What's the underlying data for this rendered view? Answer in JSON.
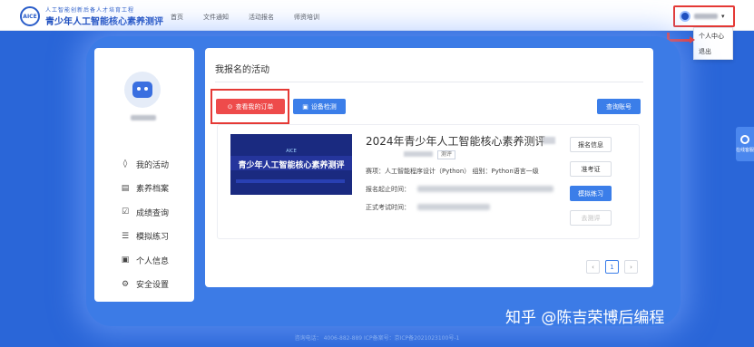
{
  "header": {
    "logo_text": "AICE",
    "brand_line1": "人工智能创新后备人才培育工程",
    "brand_line2": "青少年人工智能核心素养测评",
    "nav": [
      "首页",
      "文件通知",
      "活动报名",
      "师资培训"
    ]
  },
  "user_menu": {
    "caret": "▾",
    "items": [
      "个人中心",
      "退出"
    ]
  },
  "sidebar": {
    "items": [
      {
        "icon": "pin-icon",
        "glyph": "◊",
        "label": "我的活动"
      },
      {
        "icon": "archive-icon",
        "glyph": "▤",
        "label": "素养档案"
      },
      {
        "icon": "checkbox-icon",
        "glyph": "☑",
        "label": "成绩查询"
      },
      {
        "icon": "list-icon",
        "glyph": "☰",
        "label": "模拟练习"
      },
      {
        "icon": "id-card-icon",
        "glyph": "▣",
        "label": "个人信息"
      },
      {
        "icon": "gear-icon",
        "glyph": "⚙",
        "label": "安全设置"
      }
    ]
  },
  "main": {
    "title": "我报名的活动",
    "btn_orders": "查看我的订单",
    "btn_orders_icon": "⊙",
    "btn_device": "设备检测",
    "btn_device_icon": "▣",
    "btn_query": "查询账号"
  },
  "card": {
    "banner_top": "AICE",
    "banner_main": "青少年人工智能核心素养测评",
    "title": "2024年青少年人工智能核心素养测评",
    "tag": "测评",
    "info_project": "赛项：人工智能程序设计（Python）  组别：Python语言一级",
    "info_reg_time": "报名起止时间：",
    "info_exam_time": "正式考试时间：",
    "side_buttons": [
      "报名信息",
      "准考证",
      "模拟练习",
      "去测评"
    ]
  },
  "pager": {
    "prev": "‹",
    "current": "1",
    "next": "›"
  },
  "consult": {
    "label": "在线客服"
  },
  "footer": {
    "text": "咨询电话：  4006-882-889    ICP备案号：京ICP备2021023100号-1"
  },
  "watermark": "知乎 @陈吉荣博后编程"
}
